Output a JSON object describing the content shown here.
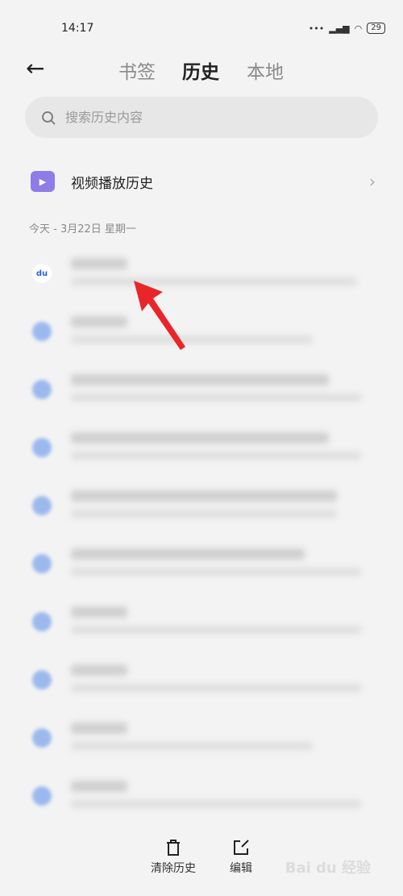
{
  "status_bar": {
    "time": "14:17",
    "battery": "29"
  },
  "header": {
    "tabs": [
      {
        "label": "书签",
        "active": false
      },
      {
        "label": "历史",
        "active": true
      },
      {
        "label": "本地",
        "active": false
      }
    ]
  },
  "search": {
    "placeholder": "搜索历史内容"
  },
  "video_history": {
    "label": "视频播放历史"
  },
  "date_header": "今天 - 3月22日 星期一",
  "bottom": {
    "clear": "清除历史",
    "edit": "编辑"
  },
  "watermark": "Baidu 经验",
  "colors": {
    "accent": "#8e7ce8",
    "arrow": "#e8262a"
  }
}
